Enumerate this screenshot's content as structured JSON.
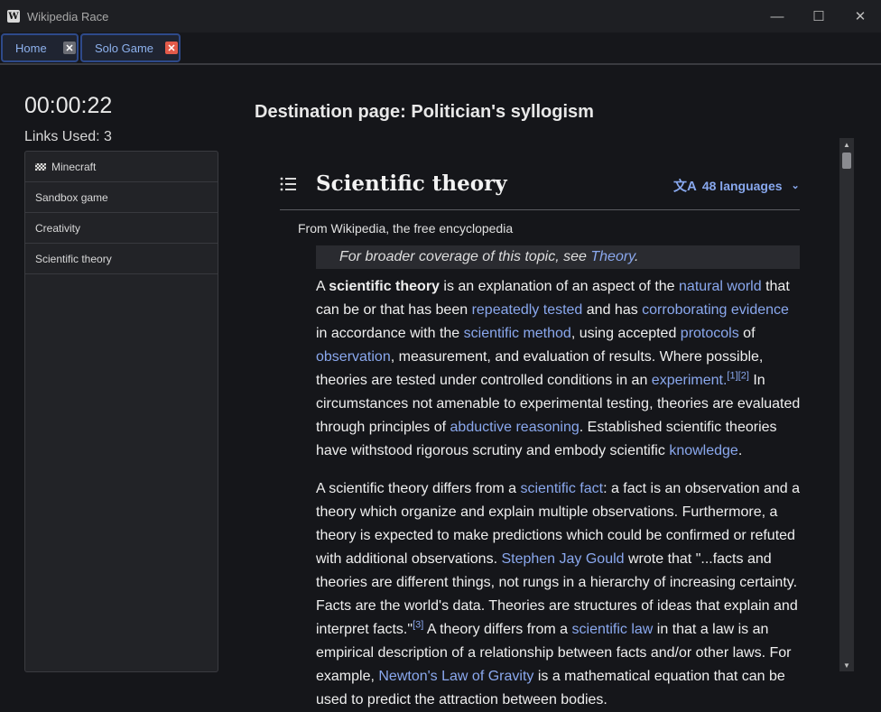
{
  "window": {
    "title": "Wikipedia Race",
    "icon_letter": "W",
    "minimize_glyph": "—",
    "maximize_glyph": "☐",
    "close_glyph": "✕"
  },
  "tabs": [
    {
      "label": "Home",
      "close_glyph": "✕",
      "close_color": "#6b6d75"
    },
    {
      "label": "Solo Game",
      "close_glyph": "✕",
      "close_color": "#e25a4a"
    }
  ],
  "game": {
    "timer": "00:00:22",
    "links_used": "Links Used: 3",
    "destination": "Destination page: Politician's syllogism"
  },
  "history": [
    {
      "label": "Minecraft",
      "icon": "checkered-flag-icon"
    },
    {
      "label": "Sandbox game"
    },
    {
      "label": "Creativity"
    },
    {
      "label": "Scientific theory"
    }
  ],
  "article": {
    "title": "Scientific theory",
    "languages": "48 languages",
    "languages_icon": "文A",
    "chevron": "⌄",
    "from": "From Wikipedia, the free encyclopedia",
    "hatnote": {
      "prefix": "For broader coverage of this topic, see ",
      "link": "Theory",
      "suffix": "."
    },
    "para1": [
      {
        "t": "A "
      },
      {
        "t": "scientific theory",
        "b": true
      },
      {
        "t": " is an explanation of an aspect of the "
      },
      {
        "t": "natural world",
        "link": true
      },
      {
        "t": " that can be or that has been "
      },
      {
        "t": "repeatedly tested",
        "link": true
      },
      {
        "t": " and has "
      },
      {
        "t": "corroborating evidence",
        "link": true
      },
      {
        "t": " in accordance with the "
      },
      {
        "t": "scientific method",
        "link": true
      },
      {
        "t": ", using accepted "
      },
      {
        "t": "protocols",
        "link": true
      },
      {
        "t": " of "
      },
      {
        "t": "observation",
        "link": true
      },
      {
        "t": ", measurement, and evaluation of results. Where possible, theories are tested under controlled conditions in an "
      },
      {
        "t": "experiment",
        "link": true
      },
      {
        "t": ".",
        "link": true
      },
      {
        "t": "[1]",
        "link": true,
        "sup": true
      },
      {
        "t": "[2]",
        "link": true,
        "sup": true
      },
      {
        "t": " In circumstances not amenable to experimental testing, theories are evaluated through principles of "
      },
      {
        "t": "abductive reasoning",
        "link": true
      },
      {
        "t": ". Established scientific theories have withstood rigorous scrutiny and embody scientific "
      },
      {
        "t": "knowledge",
        "link": true
      },
      {
        "t": "."
      }
    ],
    "para2": [
      {
        "t": "A scientific theory differs from a "
      },
      {
        "t": "scientific fact",
        "link": true
      },
      {
        "t": ": a fact is an observation and a theory which organize and explain multiple observations. Furthermore, a theory is expected to make predictions which could be confirmed or refuted with additional observations. "
      },
      {
        "t": "Stephen Jay Gould",
        "link": true
      },
      {
        "t": " wrote that \"...facts and theories are different things, not rungs in a hierarchy of increasing certainty. Facts are the world's data. Theories are structures of ideas that explain and interpret facts.\""
      },
      {
        "t": "[3]",
        "link": true,
        "sup": true
      },
      {
        "t": " A theory differs from a "
      },
      {
        "t": "scientific law",
        "link": true
      },
      {
        "t": " in that a law is an empirical description of a relationship between facts and/or other laws. For example, "
      },
      {
        "t": "Newton's Law of Gravity",
        "link": true
      },
      {
        "t": " is a mathematical equation that can be used to predict the attraction between bodies."
      }
    ]
  },
  "scrollbar": {
    "up_glyph": "▲",
    "down_glyph": "▼",
    "position": 0.0
  },
  "colors": {
    "link": "#8aa8ee",
    "tab_border": "#2e4a8a",
    "background": "#15161a"
  }
}
